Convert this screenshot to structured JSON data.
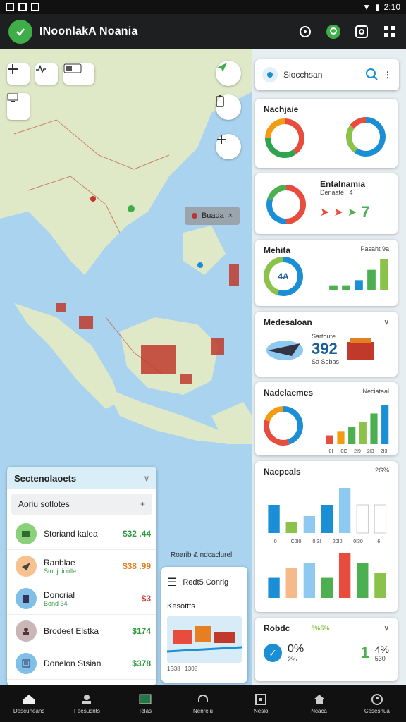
{
  "status": {
    "time": "2:10"
  },
  "app": {
    "title": "INoonlakA Noania"
  },
  "map": {
    "tooltip": "Buada",
    "legend": "Roarib & ndcaclurel"
  },
  "search": {
    "placeholder": "Slocchsan"
  },
  "cards": {
    "c1": {
      "title": "Nachjaie"
    },
    "c2": {
      "title": "Entalnamia",
      "sub": "Denaate",
      "sub2": "4",
      "value": "7"
    },
    "c3": {
      "title": "Mehita",
      "sub": "Pasaht 9a",
      "donut_label": "4A"
    },
    "c4": {
      "title": "Medesaloan",
      "sub": "Sartoute",
      "value": "392",
      "sub2": "Sa Sebas"
    },
    "c5": {
      "title": "Nadelaemes",
      "sub": "Neciataal",
      "ticks": [
        "0I",
        "0I3",
        "2I9",
        "2I3",
        "2I3"
      ]
    },
    "c6": {
      "title": "Nacpcals",
      "pct": "2G%",
      "ticks": [
        "0",
        "C0I0",
        "0I3I",
        "20I0",
        "0I30",
        "6"
      ]
    },
    "c7": {
      "title": "Robdc",
      "pct": "5%5%",
      "left_value": "0%",
      "left_sub": "2%",
      "right_value": "1",
      "right_pct": "4%",
      "right_sub": "530"
    }
  },
  "chart_data": [
    {
      "type": "pie",
      "title": "Nachjaie",
      "values": [
        40,
        35,
        25
      ],
      "colors": [
        "#e74c3c",
        "#2ea44f",
        "#f39c12"
      ]
    },
    {
      "type": "pie",
      "title": "Nachjaie",
      "values": [
        60,
        25,
        15
      ],
      "colors": [
        "#1a8fd6",
        "#8bc34a",
        "#e74c3c"
      ]
    },
    {
      "type": "pie",
      "title": "Entalnamia",
      "values": [
        50,
        30,
        20
      ],
      "colors": [
        "#e74c3c",
        "#1a8fd6",
        "#4caf50"
      ]
    },
    {
      "type": "pie",
      "title": "Mehita",
      "values": [
        55,
        45
      ],
      "colors": [
        "#1a8fd6",
        "#8bc34a"
      ]
    },
    {
      "type": "bar",
      "title": "Mehita",
      "values": [
        1,
        1,
        2,
        4,
        6
      ],
      "colors": [
        "#4caf50",
        "#4caf50",
        "#1a8fd6",
        "#4caf50",
        "#8bc34a"
      ]
    },
    {
      "type": "pie",
      "title": "Nadelaemes",
      "values": [
        45,
        35,
        20
      ],
      "colors": [
        "#1a8fd6",
        "#e74c3c",
        "#f39c12"
      ]
    },
    {
      "type": "bar",
      "title": "Nadelaemes",
      "values": [
        2,
        3,
        4,
        5,
        7,
        9
      ],
      "colors": [
        "#e74c3c",
        "#f39c12",
        "#4caf50",
        "#8bc34a",
        "#4caf50",
        "#1a8fd6"
      ]
    },
    {
      "type": "bar",
      "title": "Nacpcals",
      "values": [
        5,
        2,
        3,
        5,
        8,
        5,
        5
      ],
      "colors": [
        "#1a8fd6",
        "#8bc34a",
        "#8ec9ef",
        "#1a8fd6",
        "#8ec9ef",
        "#ffffff",
        "#ffffff"
      ]
    },
    {
      "type": "bar",
      "title": "Nacpcals",
      "values": [
        4,
        6,
        7,
        4,
        9,
        7,
        5
      ],
      "colors": [
        "#1a8fd6",
        "#f5b98a",
        "#8ec9ef",
        "#4caf50",
        "#e74c3c",
        "#4caf50",
        "#8bc34a"
      ]
    }
  ],
  "list": {
    "title": "Sectenolaoets",
    "subtitle": "Aoriu sotlotes",
    "rows": [
      {
        "name": "Storiand kalea",
        "sub": "",
        "amount": "$32 .44",
        "amount_color": "#2e9a3f",
        "icon": "ticket-icon",
        "icon_bg": "#8bd07a"
      },
      {
        "name": "Ranblae",
        "sub": "Stonjhicolle",
        "amount": "$38 .99",
        "amount_color": "#e67e22",
        "icon": "plane-icon",
        "icon_bg": "#f7c28f"
      },
      {
        "name": "Doncrial",
        "sub": "Bond 34",
        "amount": "$3",
        "amount_color": "#c0392b",
        "icon": "building-icon",
        "icon_bg": "#7fbfe8"
      },
      {
        "name": "Brodeet Elstka",
        "sub": "",
        "amount": "$174",
        "amount_color": "#2e9a3f",
        "icon": "person-icon",
        "icon_bg": "#c9b6b8"
      },
      {
        "name": "Donelon Stsian",
        "sub": "",
        "amount": "$378",
        "amount_color": "#2e9a3f",
        "icon": "list-icon",
        "icon_bg": "#7fbfe8"
      }
    ]
  },
  "mini": {
    "title": "Redt5 Conrig",
    "label": "Kesottts",
    "foot1": "1S38",
    "foot2": "1308"
  },
  "nav": [
    {
      "label": "Descuneans",
      "icon": "home-icon"
    },
    {
      "label": "Feesusnts",
      "icon": "group-icon"
    },
    {
      "label": "Telas",
      "icon": "tv-icon"
    },
    {
      "label": "Nenrelu",
      "icon": "headset-icon"
    },
    {
      "label": "Neslo",
      "icon": "frame-icon"
    },
    {
      "label": "Ncaca",
      "icon": "house-icon"
    },
    {
      "label": "Ceseshua",
      "icon": "user-icon"
    }
  ]
}
